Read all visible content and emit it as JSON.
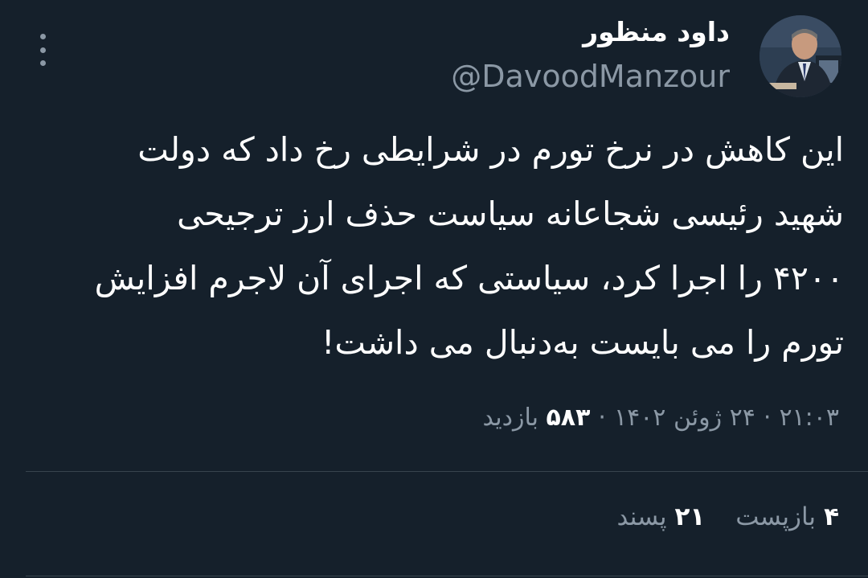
{
  "author": {
    "name": "داود منظور",
    "handle": "@DavoodManzour"
  },
  "tweet": {
    "lines": [
      "این کاهش در نرخ تورم در شرایطی رخ داد که دولت",
      "شهید رئیسی شجاعانه سیاست حذف ارز ترجیحی",
      "۴۲۰۰ را اجرا کرد، سیاستی که اجرای آن لاجرم افزایش",
      "تورم را می بایست به‌دنبال می داشت!"
    ]
  },
  "meta": {
    "time": "۲۱:۰۳",
    "date": "۲۴ ژوئن ۱۴۰۲",
    "separator": "·",
    "views_count": "۵۸۳",
    "views_label": "بازدید"
  },
  "stats": {
    "retweets_count": "۴",
    "retweets_label": "بازپست",
    "likes_count": "۲۱",
    "likes_label": "پسند"
  },
  "icons": {
    "more": "more-vertical-icon"
  },
  "colors": {
    "background": "#15202b",
    "secondary_text": "#8b98a5",
    "divider": "#38444d"
  }
}
